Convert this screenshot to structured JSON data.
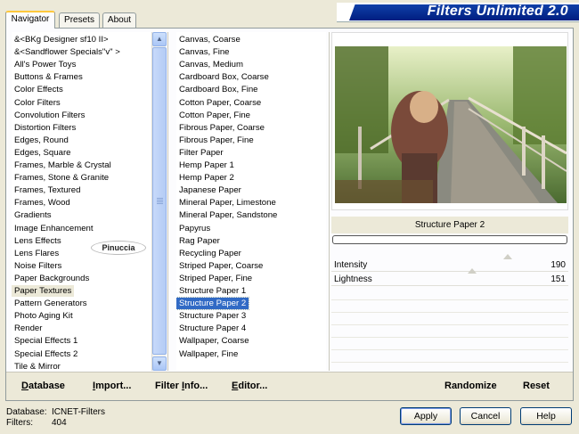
{
  "app": {
    "title": "Filters Unlimited 2.0"
  },
  "tabs": [
    {
      "label": "Navigator",
      "active": true
    },
    {
      "label": "Presets",
      "active": false
    },
    {
      "label": "About",
      "active": false
    }
  ],
  "categories": {
    "selected": "Paper Textures",
    "items": [
      "&<BKg Designer sf10 II>",
      "&<Sandflower Specials\"v\" >",
      "All's Power Toys",
      "Buttons & Frames",
      "Color Effects",
      "Color Filters",
      "Convolution Filters",
      "Distortion Filters",
      "Edges, Round",
      "Edges, Square",
      "Frames, Marble & Crystal",
      "Frames, Stone & Granite",
      "Frames, Textured",
      "Frames, Wood",
      "Gradients",
      "Image Enhancement",
      "Lens Effects",
      "Lens Flares",
      "Noise Filters",
      "Paper Backgrounds",
      "Paper Textures",
      "Pattern Generators",
      "Photo Aging Kit",
      "Render",
      "Special Effects 1",
      "Special Effects 2",
      "Tile & Mirror"
    ]
  },
  "filters": {
    "selected": "Structure Paper 2",
    "items": [
      "Canvas, Coarse",
      "Canvas, Fine",
      "Canvas, Medium",
      "Cardboard Box, Coarse",
      "Cardboard Box, Fine",
      "Cotton Paper, Coarse",
      "Cotton Paper, Fine",
      "Fibrous Paper, Coarse",
      "Fibrous Paper, Fine",
      "Filter Paper",
      "Hemp Paper 1",
      "Hemp Paper 2",
      "Japanese Paper",
      "Mineral Paper, Limestone",
      "Mineral Paper, Sandstone",
      "Papyrus",
      "Rag Paper",
      "Recycling Paper",
      "Striped Paper, Coarse",
      "Striped Paper, Fine",
      "Structure Paper 1",
      "Structure Paper 2",
      "Structure Paper 3",
      "Structure Paper 4",
      "Wallpaper, Coarse",
      "Wallpaper, Fine"
    ]
  },
  "watermark": "Pinuccia",
  "preview": {
    "filter_name": "Structure Paper 2",
    "progress": 0
  },
  "params": [
    {
      "label": "Intensity",
      "value": "190",
      "max": 255
    },
    {
      "label": "Lightness",
      "value": "151",
      "max": 255
    }
  ],
  "toolbar": {
    "database_prefix": "D",
    "database_rest": "atabase",
    "import_prefix": "I",
    "import_rest": "mport...",
    "filterinfo_pre": "Filter ",
    "filterinfo_u": "I",
    "filterinfo_rest": "nfo...",
    "editor_prefix": "E",
    "editor_rest": "ditor...",
    "randomize": "Randomize",
    "reset": "Reset"
  },
  "status": {
    "database_label": "Database:",
    "database_value": "ICNET-Filters",
    "filters_label": "Filters:",
    "filters_value": "404"
  },
  "buttons": {
    "apply": "Apply",
    "cancel": "Cancel",
    "help": "Help"
  },
  "colors": {
    "selection": "#316ac5",
    "banner": "#0a2f99"
  }
}
